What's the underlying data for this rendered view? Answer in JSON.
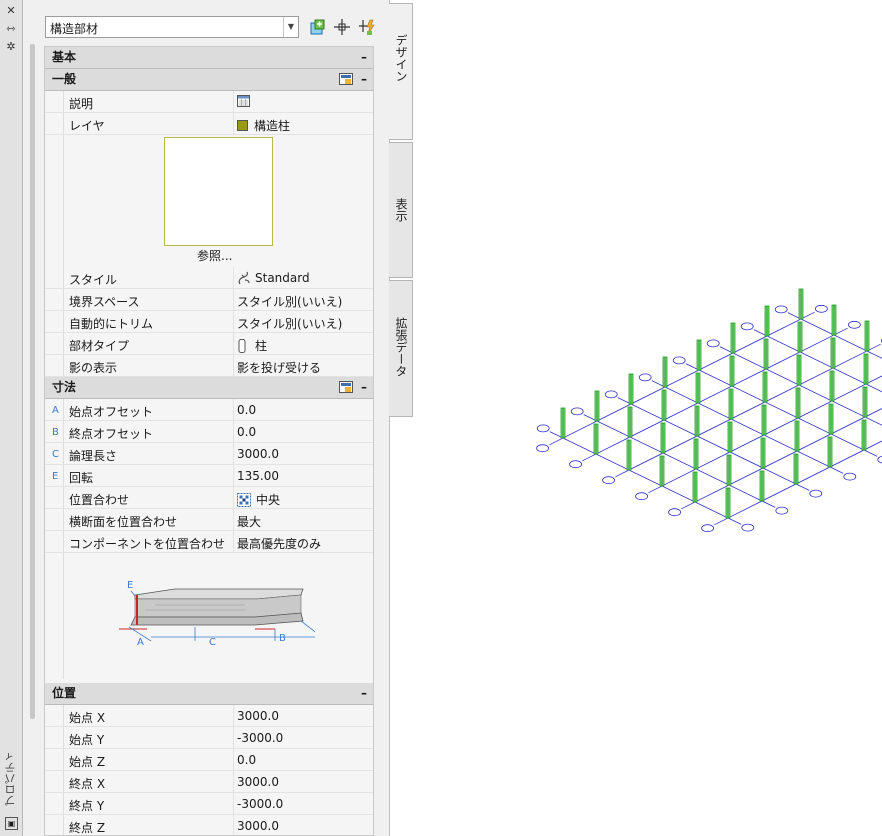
{
  "palette": {
    "panel_bg": "#f0f0f0",
    "section_bg": "#dcdcdc",
    "layer_swatch": "#9a9a12",
    "dimension_blue": "#3e7bc9",
    "grid_line": "#2f2fd0",
    "column_green": "#1fa31f"
  },
  "titlebar": {
    "title": "プロパティ",
    "close_icon": "close-icon",
    "autohide_icon": "autohide-icon",
    "settings_icon": "settings-icon"
  },
  "palette_header": {
    "selection": "構造部材",
    "tools": [
      "add-selected-icon",
      "pick-point-icon",
      "quick-select-icon"
    ]
  },
  "sections": {
    "basic": "基本",
    "general": "一般",
    "dimensions": "寸法",
    "location": "位置"
  },
  "general": {
    "description": {
      "label": "説明",
      "icon": "description-editor-icon"
    },
    "layer": {
      "label": "レイヤ",
      "value": "構造柱"
    },
    "preview_link": "参照...",
    "rows": [
      {
        "label": "スタイル",
        "value": "Standard",
        "icon": "style-icon"
      },
      {
        "label": "境界スペース",
        "value": "スタイル別(いいえ)"
      },
      {
        "label": "自動的にトリム",
        "value": "スタイル別(いいえ)"
      },
      {
        "label": "部材タイプ",
        "value": "柱",
        "icon": "member-type-icon"
      },
      {
        "label": "影の表示",
        "value": "影を投げ受ける"
      }
    ]
  },
  "dimensions": {
    "rows": [
      {
        "code": "A",
        "label": "始点オフセット",
        "value": "0.0"
      },
      {
        "code": "B",
        "label": "終点オフセット",
        "value": "0.0"
      },
      {
        "code": "C",
        "label": "論理長さ",
        "value": "3000.0"
      },
      {
        "code": "E",
        "label": "回転",
        "value": "135.00"
      },
      {
        "code": "",
        "label": "位置合わせ",
        "value": "中央",
        "icon": "justify-icon"
      },
      {
        "code": "",
        "label": "横断面を位置合わせ",
        "value": "最大"
      },
      {
        "code": "",
        "label": "コンポーネントを位置合わせ",
        "value": "最高優先度のみ"
      }
    ],
    "diagram_labels": {
      "e": "E",
      "a": "A",
      "c": "C",
      "b": "B"
    }
  },
  "location": {
    "rows": [
      {
        "label": "始点 X",
        "value": "3000.0"
      },
      {
        "label": "始点 Y",
        "value": "-3000.0"
      },
      {
        "label": "始点 Z",
        "value": "0.0"
      },
      {
        "label": "終点 X",
        "value": "3000.0"
      },
      {
        "label": "終点 Y",
        "value": "-3000.0"
      },
      {
        "label": "終点 Z",
        "value": "3000.0"
      }
    ]
  },
  "tabs": [
    "デザイン",
    "表示",
    "拡張データ"
  ]
}
